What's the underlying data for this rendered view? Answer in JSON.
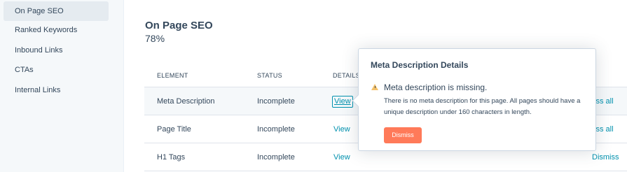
{
  "sidebar": {
    "items": [
      {
        "label": "On Page SEO",
        "active": true
      },
      {
        "label": "Ranked Keywords"
      },
      {
        "label": "Inbound Links"
      },
      {
        "label": "CTAs"
      },
      {
        "label": "Internal Links"
      }
    ]
  },
  "main": {
    "title": "On Page SEO",
    "score": "78%",
    "columns": [
      "ELEMENT",
      "STATUS",
      "DETAILS"
    ],
    "rows": [
      {
        "element": "Meta Description",
        "status": "Incomplete",
        "details": "View",
        "action": "Dismiss all"
      },
      {
        "element": "Page Title",
        "status": "Incomplete",
        "details": "View",
        "action": "Dismiss all"
      },
      {
        "element": "H1 Tags",
        "status": "Incomplete",
        "details": "View",
        "action": "Dismiss all"
      }
    ]
  },
  "popover": {
    "title": "Meta Description Details",
    "warning_icon": "warning-triangle-icon",
    "heading": "Meta description is missing.",
    "body": "There is no meta description for this page. All pages should have a unique description under 160 characters in length.",
    "button": "Dismiss"
  },
  "colors": {
    "sidebar_bg": "#f5f8fa",
    "link": "#0091ae",
    "button": "#ff7a59",
    "warning": "#f5c26b",
    "text": "#33475b"
  }
}
